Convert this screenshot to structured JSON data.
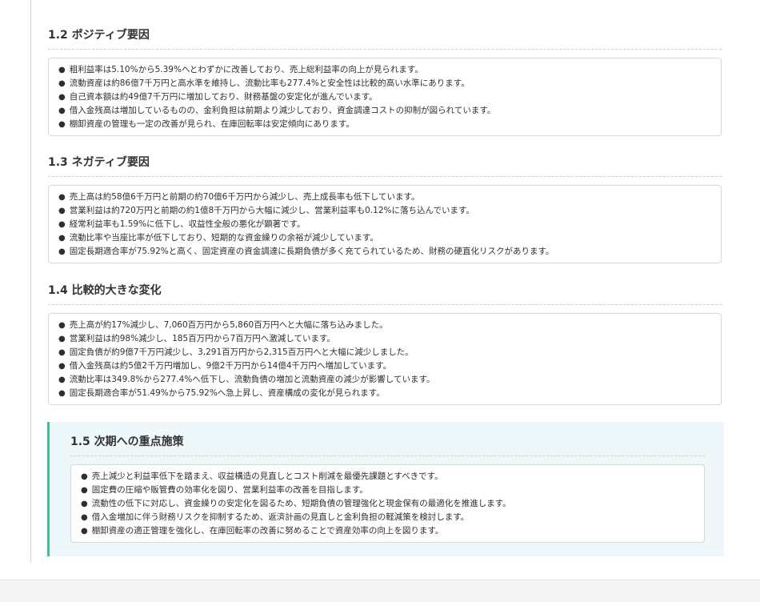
{
  "sections": [
    {
      "title": "1.2 ポジティブ要因",
      "items": [
        "粗利益率は5.10%から5.39%へとわずかに改善しており、売上総利益率の向上が見られます。",
        "流動資産は約86億7千万円と高水準を維持し、流動比率も277.4%と安全性は比較的高い水準にあります。",
        "自己資本額は約49億7千万円に増加しており、財務基盤の安定化が進んでいます。",
        "借入金残高は増加しているものの、金利負担は前期より減少しており、資金調達コストの抑制が図られています。",
        "棚卸資産の管理も一定の改善が見られ、在庫回転率は安定傾向にあります。"
      ]
    },
    {
      "title": "1.3 ネガティブ要因",
      "items": [
        "売上高は約58億6千万円と前期の約70億6千万円から減少し、売上成長率も低下しています。",
        "営業利益は約720万円と前期の約1億8千万円から大幅に減少し、営業利益率も0.12%に落ち込んでいます。",
        "経常利益率も1.59%に低下し、収益性全般の悪化が顕著です。",
        "流動比率や当座比率が低下しており、短期的な資金繰りの余裕が減少しています。",
        "固定長期適合率が75.92%と高く、固定資産の資金調達に長期負債が多く充てられているため、財務の硬直化リスクがあります。"
      ]
    },
    {
      "title": "1.4 比較的大きな変化",
      "items": [
        "売上高が約17%減少し、7,060百万円から5,860百万円へと大幅に落ち込みました。",
        "営業利益は約98%減少し、185百万円から7百万円へ激減しています。",
        "固定負債が約9億7千万円減少し、3,291百万円から2,315百万円へと大幅に減少しました。",
        "借入金残高は約5億2千万円増加し、9億2千万円から14億4千万円へ増加しています。",
        "流動比率は349.8%から277.4%へ低下し、流動負債の増加と流動資産の減少が影響しています。",
        "固定長期適合率が51.49%から75.92%へ急上昇し、資産構成の変化が見られます。"
      ]
    }
  ],
  "focus": {
    "title": "1.5 次期への重点施策",
    "items": [
      "売上減少と利益率低下を踏まえ、収益構造の見直しとコスト削減を最優先課題とすべきです。",
      "固定費の圧縮や販管費の効率化を図り、営業利益率の改善を目指します。",
      "流動性の低下に対応し、資金繰りの安定化を図るため、短期負債の管理強化と現金保有の最適化を推進します。",
      "借入金増加に伴う財務リスクを抑制するため、返済計画の見直しと金利負担の軽減策を検討します。",
      "棚卸資産の適正管理を強化し、在庫回転率の改善に努めることで資産効率の向上を図ります。"
    ],
    "accent_color": "#3bbf96"
  }
}
